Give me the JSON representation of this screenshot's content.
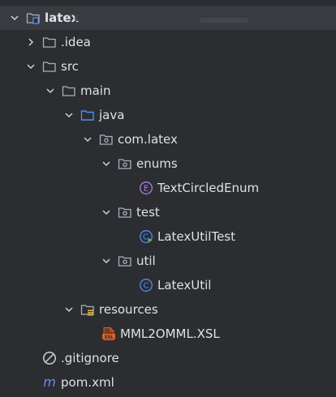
{
  "colors": {
    "background": "#2b2d30",
    "selection": "#393b40",
    "folder_stroke": "#a9b1bb",
    "source_folder": "#4e8cf7",
    "enum_icon": "#b07cf0",
    "class_icon": "#4e8cf7",
    "run_mark": "#5fb865",
    "xsl_icon": "#d6632d"
  },
  "tree": {
    "root": {
      "label": "latex",
      "icon": "module-folder-icon",
      "expanded": true
    },
    "idea": {
      "label": ".idea",
      "icon": "folder-icon",
      "expanded": false
    },
    "src": {
      "label": "src",
      "icon": "folder-icon",
      "expanded": true
    },
    "main": {
      "label": "main",
      "icon": "folder-icon",
      "expanded": true
    },
    "java": {
      "label": "java",
      "icon": "source-folder-icon",
      "expanded": true
    },
    "pkg": {
      "label": "com.latex",
      "icon": "package-icon",
      "expanded": true
    },
    "enums_pkg": {
      "label": "enums",
      "icon": "package-icon",
      "expanded": true
    },
    "enum_class": {
      "label": "TextCircledEnum",
      "icon": "enum-icon",
      "badge": "E"
    },
    "test_pkg": {
      "label": "test",
      "icon": "package-icon",
      "expanded": true
    },
    "test_class": {
      "label": "LatexUtilTest",
      "icon": "test-class-icon",
      "badge": "C"
    },
    "util_pkg": {
      "label": "util",
      "icon": "package-icon",
      "expanded": true
    },
    "util_class": {
      "label": "LatexUtil",
      "icon": "class-icon",
      "badge": "C"
    },
    "resources": {
      "label": "resources",
      "icon": "resources-folder-icon",
      "expanded": true
    },
    "xsl_file": {
      "label": "MML2OMML.XSL",
      "icon": "xsl-file-icon",
      "badge": "XSL"
    },
    "gitignore": {
      "label": ".gitignore",
      "icon": "ignore-file-icon"
    },
    "pom": {
      "label": "pom.xml",
      "icon": "maven-icon",
      "badge": "m"
    }
  }
}
